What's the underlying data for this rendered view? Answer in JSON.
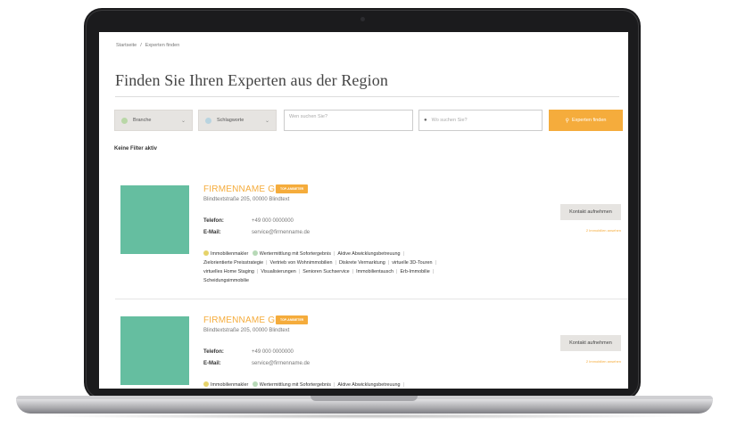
{
  "breadcrumb": {
    "home": "Startseite",
    "separator": "/",
    "current": "Experten finden"
  },
  "page": {
    "title": "Finden Sie Ihren Experten aus der Region"
  },
  "filters": {
    "branche": "Branche",
    "schlagworte": "Schlagworte",
    "who_placeholder": "Wen suchen Sie?",
    "where_placeholder": "Wo suchen Sie?",
    "search_button": "Experten finden"
  },
  "active_filters_text": "Keine Filter aktiv",
  "listings": [
    {
      "name": "FIRMENNAME GMBH",
      "badge": "TOP-ANBIETER",
      "address": "Blindtextstraße 205, 00000 Blindtext",
      "phone_label": "Telefon:",
      "phone": "+49 000 0000000",
      "email_label": "E-Mail:",
      "email": "service@firmenname.de",
      "category_1": "Immobilienmakler",
      "category_2": "Wertermittlung mit Sofortergebnis",
      "tags": [
        "Aktive Abwicklungsbetreuung",
        "Zielorientierte Preisstrategie",
        "Vertrieb von Wohnimmobilien",
        "Diskrete Vermarktung",
        "virtuelle 3D-Touren",
        "virtuelles Home Staging",
        "Visualisierungen",
        "Senioren Suchservice",
        "Immobilientausch",
        "Erb-Immobilie",
        "Scheidungsimmobilie"
      ],
      "contact_button": "Kontakt aufnehmen",
      "properties_link": "2 Immobilien ansehen"
    },
    {
      "name": "FIRMENNAME GMBH",
      "badge": "TOP-ANBIETER",
      "address": "Blindtextstraße 205, 00000 Blindtext",
      "phone_label": "Telefon:",
      "phone": "+49 000 0000000",
      "email_label": "E-Mail:",
      "email": "service@firmenname.de",
      "category_1": "Immobilienmakler",
      "category_2": "Wertermittlung mit Sofortergebnis",
      "tags": [
        "Aktive Abwicklungsbetreuung"
      ],
      "contact_button": "Kontakt aufnehmen",
      "properties_link": "2 Immobilien ansehen"
    }
  ],
  "colors": {
    "accent": "#f5ac3c",
    "thumbnail": "#65bea0",
    "select_bg": "#e6e4e1"
  },
  "icons": {
    "search": "magnifier-icon",
    "location": "map-pin-icon",
    "dropdown": "chevron-down-icon"
  }
}
